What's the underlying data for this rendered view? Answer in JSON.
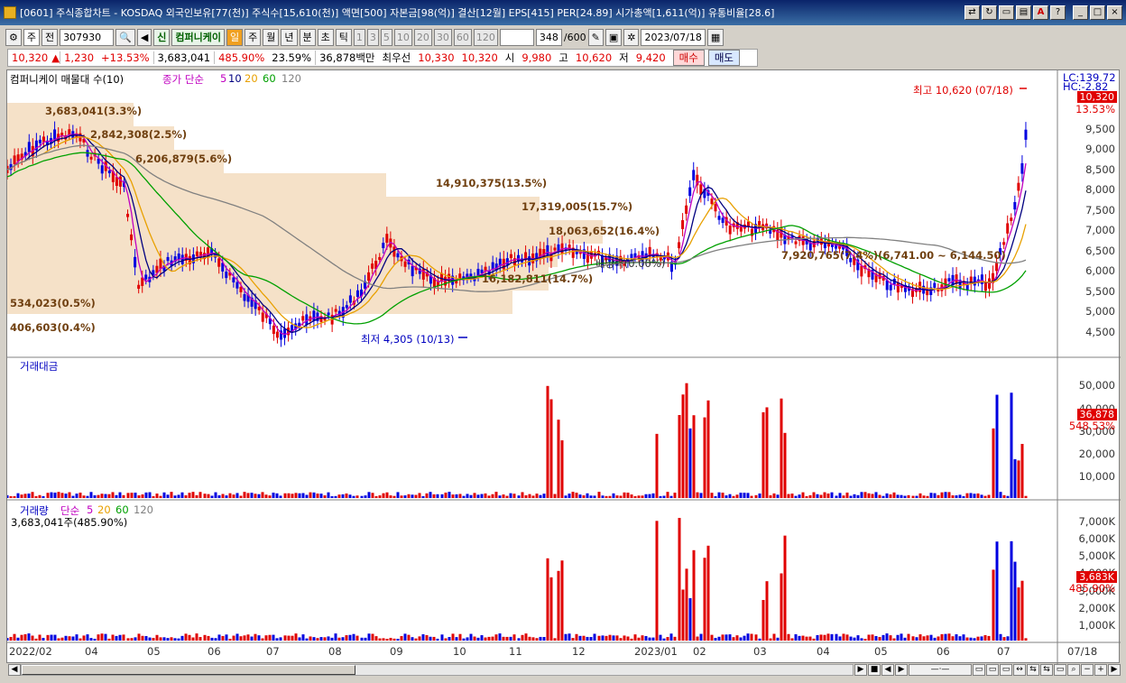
{
  "window": {
    "title": "[0601] 주식종합차트 - KOSDAQ 외국인보유[77(천)] 주식수[15,610(천)] 액면[500] 자본금[98(억)] 결산[12월] EPS[415] PER[24.89] 시가총액[1,611(억)] 유통비율[28.6]"
  },
  "toolbar": {
    "period": "주",
    "prev": "전",
    "code": "307930",
    "sin": "신",
    "name": "컴퍼니케이",
    "units": [
      "일",
      "주",
      "월",
      "년",
      "분",
      "초",
      "틱"
    ],
    "nums": [
      "1",
      "3",
      "5",
      "10",
      "20",
      "30",
      "60",
      "120"
    ],
    "count": "348",
    "count_total": "/600",
    "date": "2023/07/18"
  },
  "quote": {
    "price": "10,320",
    "arrow": "▲",
    "change": "1,230",
    "pct": "+13.53%",
    "volume": "3,683,041",
    "vol_ratio": "485.90%",
    "turnover": "23.59%",
    "amount": "36,878백만",
    "best_label": "최우선",
    "ask": "10,330",
    "bid": "10,320",
    "open_label": "시",
    "open": "9,980",
    "high_label": "고",
    "high": "10,620",
    "low_label": "저",
    "low": "9,420",
    "buy": "매수",
    "sell": "매도"
  },
  "price_panel": {
    "legend_title": "컴퍼니케이 매물대 수(10)",
    "legend_ma": "종가 단순",
    "ma": [
      "5",
      "10",
      "20",
      "60",
      "120"
    ],
    "lc": "LC:139.72",
    "hc": "HC:-2.82",
    "current_tag": "10,320",
    "current_pct": "13.53%",
    "ticks": [
      "9,500",
      "9,000",
      "8,500",
      "8,000",
      "7,500",
      "7,000",
      "6,500",
      "6,000",
      "5,500",
      "5,000",
      "4,500"
    ],
    "high_label": "최고 10,620 (07/18)",
    "low_label": "최저 4,305 (10/13)",
    "profile_labels": [
      "3,683,041(3.3%)",
      "2,842,308(2.5%)",
      "6,206,879(5.6%)",
      "14,910,375(13.5%)",
      "17,319,005(15.7%)",
      "18,063,652(16.4%)",
      "16,182,811(14.7%)",
      "7,920,765(7.4%)(6,741.00 ~ 6,144.50)",
      "534,023(0.5%)",
      "406,603(0.4%)",
      "배당락(0.00%)"
    ]
  },
  "amount_panel": {
    "title": "거래대금",
    "ticks": [
      "50,000",
      "40,000",
      "30,000",
      "20,000",
      "10,000"
    ],
    "current_tag": "36,878",
    "current_pct": "548.53%"
  },
  "volume_panel": {
    "title": "거래량",
    "ma_label": "단순",
    "ma": [
      "5",
      "20",
      "60",
      "120"
    ],
    "current": "3,683,041주(485.90%)",
    "ticks": [
      "7,000K",
      "6,000K",
      "5,000K",
      "4,000K",
      "3,000K",
      "2,000K",
      "1,000K"
    ],
    "current_tag": "3,683K",
    "current_pct": "485.90%"
  },
  "x_axis": [
    "2022/02",
    "04",
    "05",
    "06",
    "07",
    "08",
    "09",
    "10",
    "11",
    "12",
    "2023/01",
    "02",
    "03",
    "04",
    "05",
    "06",
    "07",
    "07/18"
  ],
  "colors": {
    "up": "#e00000",
    "down": "#0000e0",
    "ma5": "#c000c0",
    "ma10": "#000080",
    "ma20": "#e8a000",
    "ma60": "#00a000",
    "ma120": "#808080",
    "profile": "#f5e1c8"
  }
}
